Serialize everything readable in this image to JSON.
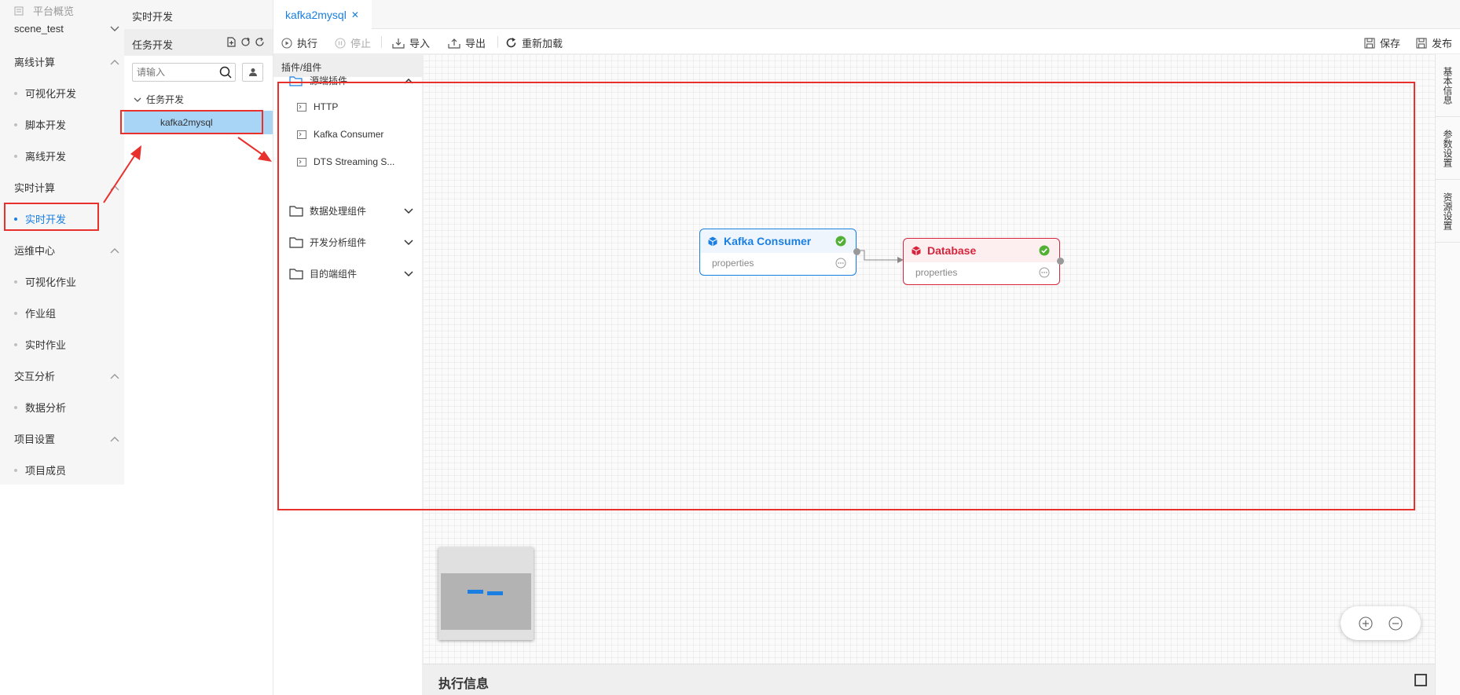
{
  "nav": {
    "overview": "平台概览",
    "project": "scene_test",
    "groups": [
      {
        "label": "离线计算",
        "items": [
          "可视化开发",
          "脚本开发",
          "离线开发"
        ]
      },
      {
        "label": "实时计算",
        "items": [
          "实时开发"
        ]
      },
      {
        "label": "运维中心",
        "items": [
          "可视化作业",
          "作业组",
          "实时作业"
        ]
      },
      {
        "label": "交互分析",
        "items": [
          "数据分析"
        ]
      },
      {
        "label": "项目设置",
        "items": [
          "项目成员"
        ]
      }
    ]
  },
  "taskpanel": {
    "title": "实时开发",
    "subtitle": "任务开发",
    "search_placeholder": "请输入",
    "folder": "任务开发",
    "selected_task": "kafka2mysql"
  },
  "tabs": [
    {
      "label": "kafka2mysql",
      "close": "✕"
    }
  ],
  "toolbar": {
    "run": "执行",
    "stop": "停止",
    "import": "导入",
    "export": "导出",
    "reload": "重新加载",
    "save": "保存",
    "publish": "发布"
  },
  "plugins": {
    "header": "插件/组件",
    "groups": [
      {
        "label": "源端插件",
        "expanded": true,
        "items": [
          "HTTP",
          "Kafka Consumer",
          "DTS Streaming S..."
        ]
      },
      {
        "label": "数据处理组件",
        "expanded": false
      },
      {
        "label": "开发分析组件",
        "expanded": false
      },
      {
        "label": "目的端组件",
        "expanded": false
      }
    ]
  },
  "nodes": {
    "source": {
      "title": "Kafka Consumer",
      "body": "properties",
      "color": "#1a7fe0",
      "status": "ok"
    },
    "target": {
      "title": "Database",
      "body": "properties",
      "color": "#d6253c",
      "status": "ok"
    }
  },
  "exec_info": {
    "title": "执行信息"
  },
  "right_tabs": [
    "基本信息",
    "参数设置",
    "资源设置"
  ],
  "colors": {
    "accent": "#1a7fe0",
    "annotation": "#e8312d",
    "success": "#52b135"
  }
}
